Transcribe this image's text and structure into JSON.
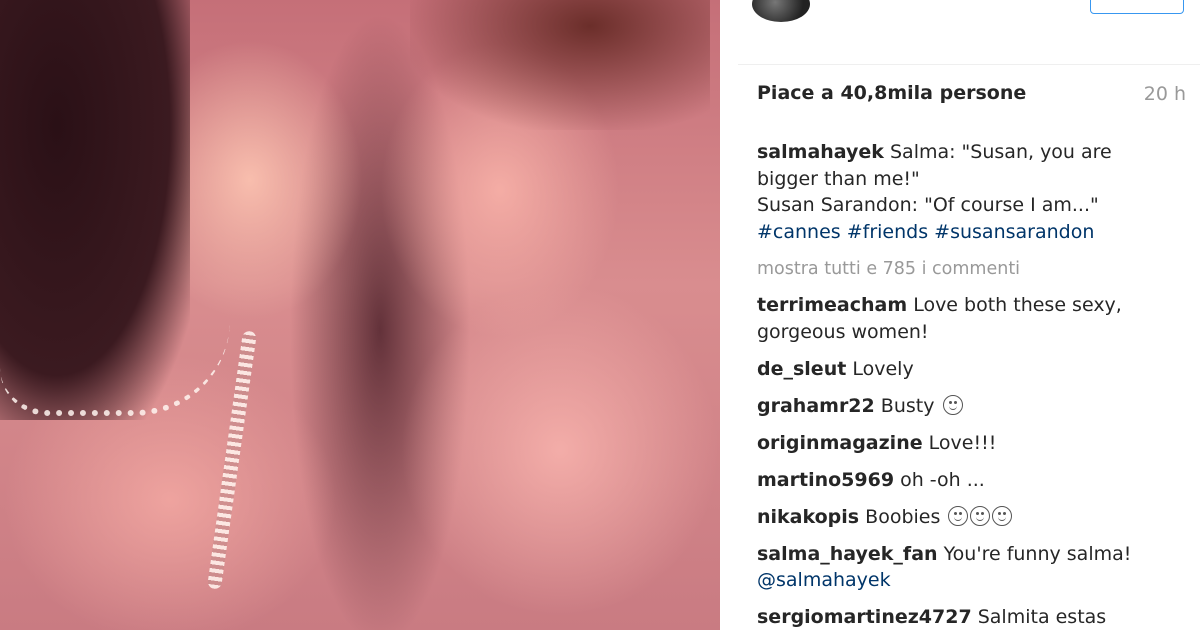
{
  "post": {
    "likes": "Piace a 40,8mila persone",
    "time": "20 h"
  },
  "caption": {
    "user": "salmahayek",
    "line1": "Salma: \"Susan, you are",
    "line2": "bigger than me!\"",
    "line3": "Susan Sarandon: \"Of course I am...\"",
    "tags": [
      "#cannes",
      "#friends",
      "#susansarandon"
    ]
  },
  "show_all": "mostra tutti e 785 i commenti",
  "comments": [
    {
      "user": "terrimeacham",
      "text1": "Love both these sexy,",
      "text2": "gorgeous women!"
    },
    {
      "user": "de_sleut",
      "text1": "Lovely"
    },
    {
      "user": "grahamr22",
      "text1": "Busty",
      "emoji_count": 1
    },
    {
      "user": "originmagazine",
      "text1": "Love!!!"
    },
    {
      "user": "martino5969",
      "text1": "oh -oh ..."
    },
    {
      "user": "nikakopis",
      "text1": "Boobies",
      "emoji_count": 3
    },
    {
      "user": "salma_hayek_fan",
      "text1": "You're funny salma!",
      "mention": "@salmahayek"
    },
    {
      "user": "sergiomartinez4727",
      "text1": "Salmita estas"
    }
  ],
  "colors": {
    "username": "#262626",
    "hashtag": "#003569",
    "muted": "#999999",
    "follow_border": "#3897f0"
  },
  "icons": {
    "emoji": "smiling-face-icon"
  }
}
